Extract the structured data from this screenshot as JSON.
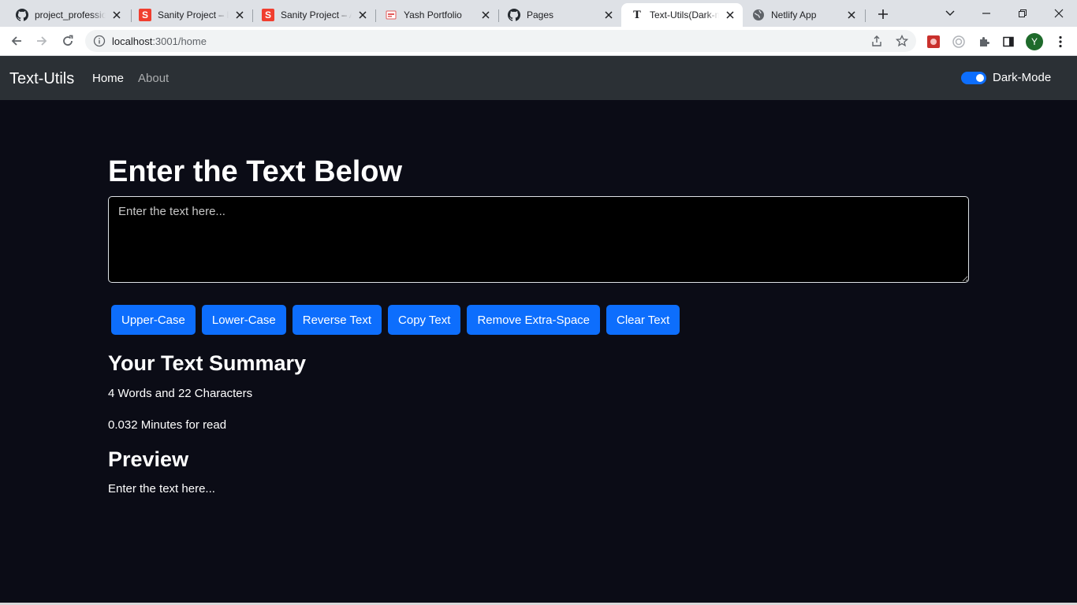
{
  "browser": {
    "tabs": [
      {
        "title": "project_professio",
        "icon": "github-icon"
      },
      {
        "title": "Sanity Project – D",
        "icon": "sanity-icon"
      },
      {
        "title": "Sanity Project – A",
        "icon": "sanity-icon"
      },
      {
        "title": "Yash Portfolio",
        "icon": "pdf-icon"
      },
      {
        "title": "Pages",
        "icon": "github-icon"
      },
      {
        "title": "Text-Utils(Dark-m",
        "icon": "t-icon",
        "active": true
      },
      {
        "title": "Netlify App",
        "icon": "globe-icon"
      }
    ],
    "url_host": "localhost",
    "url_path": ":3001/home",
    "profile_initial": "Y",
    "favicon_letters": {
      "sanity": "S",
      "textutils": "T"
    }
  },
  "app": {
    "brand": "Text-Utils",
    "nav": {
      "home": "Home",
      "about": "About"
    },
    "mode_label": "Dark-Mode",
    "mode_enabled": true
  },
  "form": {
    "heading": "Enter the Text Below",
    "placeholder": "Enter the text here...",
    "value": ""
  },
  "buttons": {
    "upper": "Upper-Case",
    "lower": "Lower-Case",
    "reverse": "Reverse Text",
    "copy": "Copy Text",
    "remove_space": "Remove Extra-Space",
    "clear": "Clear Text"
  },
  "summary": {
    "heading": "Your Text Summary",
    "counts": "4 Words and 22 Characters",
    "read_time": "0.032 Minutes for read"
  },
  "preview": {
    "heading": "Preview",
    "text": "Enter the text here..."
  },
  "colors": {
    "primary": "#0d6efd",
    "navbar": "#2b3035",
    "page_bg": "#0b0c16",
    "textarea_bg": "#000000"
  }
}
